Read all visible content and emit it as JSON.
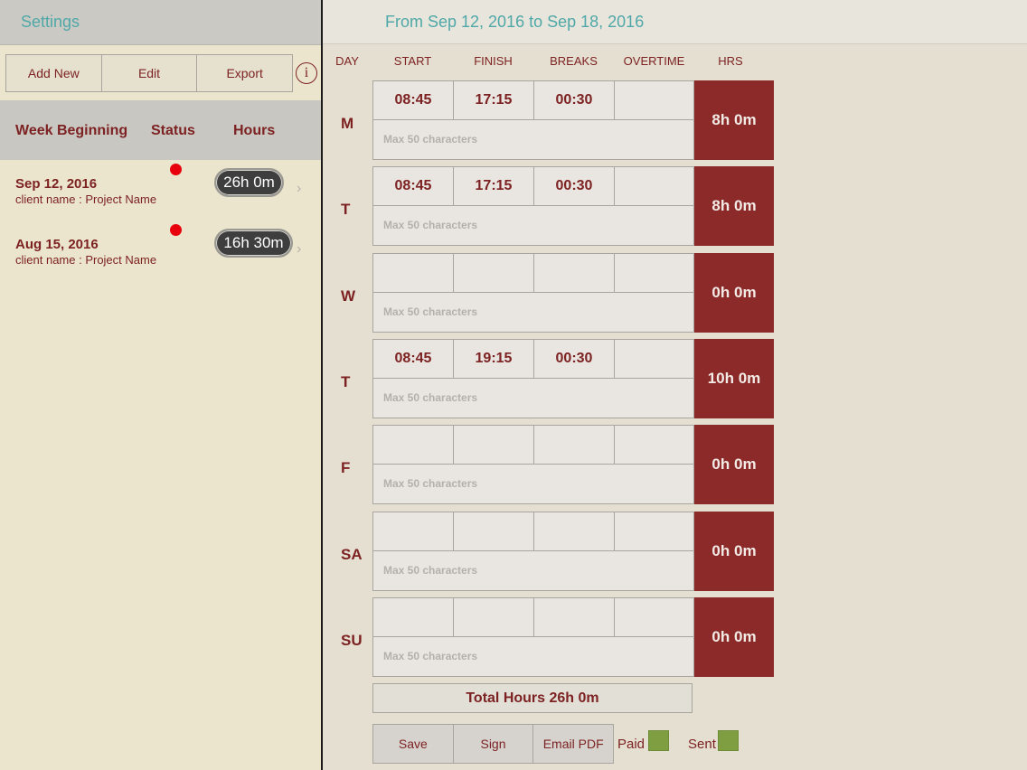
{
  "sidebar": {
    "settings_label": "Settings",
    "toolbar": {
      "add_new": "Add New",
      "edit": "Edit",
      "export": "Export",
      "info": "i"
    },
    "list_header": {
      "week_beginning": "Week Beginning",
      "status": "Status",
      "hours": "Hours"
    },
    "weeks": [
      {
        "date": "Sep 12, 2016",
        "client": "client name : Project Name",
        "hours": "26h 0m",
        "status_color": "#e8000c"
      },
      {
        "date": "Aug 15, 2016",
        "client": "client name : Project Name",
        "hours": "16h 30m",
        "status_color": "#e8000c"
      }
    ]
  },
  "timesheet": {
    "range": "From Sep 12, 2016 to Sep 18, 2016",
    "columns": {
      "day": "DAY",
      "start": "START",
      "finish": "FINISH",
      "breaks": "BREAKS",
      "overtime": "OVERTIME",
      "hrs": "HRS"
    },
    "note_placeholder": "Max 50 characters",
    "days": [
      {
        "label": "M",
        "start": "08:45",
        "finish": "17:15",
        "breaks": "00:30",
        "overtime": "",
        "hrs": "8h 0m"
      },
      {
        "label": "T",
        "start": "08:45",
        "finish": "17:15",
        "breaks": "00:30",
        "overtime": "",
        "hrs": "8h 0m"
      },
      {
        "label": "W",
        "start": "",
        "finish": "",
        "breaks": "",
        "overtime": "",
        "hrs": "0h 0m"
      },
      {
        "label": "T",
        "start": "08:45",
        "finish": "19:15",
        "breaks": "00:30",
        "overtime": "",
        "hrs": "10h 0m"
      },
      {
        "label": "F",
        "start": "",
        "finish": "",
        "breaks": "",
        "overtime": "",
        "hrs": "0h 0m"
      },
      {
        "label": "SA",
        "start": "",
        "finish": "",
        "breaks": "",
        "overtime": "",
        "hrs": "0h 0m"
      },
      {
        "label": "SU",
        "start": "",
        "finish": "",
        "breaks": "",
        "overtime": "",
        "hrs": "0h 0m"
      }
    ],
    "total": "Total Hours 26h 0m",
    "actions": {
      "save": "Save",
      "sign": "Sign",
      "email_pdf": "Email PDF"
    },
    "paid_label": "Paid",
    "sent_label": "Sent"
  },
  "colors": {
    "accent": "#4fa8a8",
    "brand": "#7d2222",
    "hrs_bg": "#8c2a2a",
    "checkbox": "#7f9e42"
  }
}
